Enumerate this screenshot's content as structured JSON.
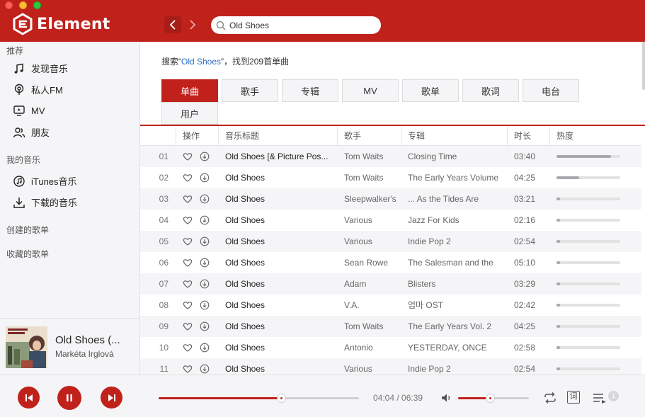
{
  "header": {
    "app_name": "Element",
    "search_value": "Old Shoes",
    "colors": {
      "brand": "#c0221b",
      "link": "#2b6fc5"
    }
  },
  "sidebar": {
    "section_recommend": "推荐",
    "items_recommend": [
      {
        "label": "发现音乐",
        "icon": "music-note-icon"
      },
      {
        "label": "私人FM",
        "icon": "radio-icon"
      },
      {
        "label": "MV",
        "icon": "tv-icon"
      },
      {
        "label": "朋友",
        "icon": "friends-icon"
      }
    ],
    "section_my_music": "我的音乐",
    "items_my_music": [
      {
        "label": "iTunes音乐",
        "icon": "itunes-icon"
      },
      {
        "label": "下载的音乐",
        "icon": "download-icon"
      }
    ],
    "section_created": "创建的歌单",
    "section_collected": "收藏的歌单"
  },
  "now_playing": {
    "title": "Old Shoes (...",
    "artist": "Markéta Irglová"
  },
  "search_result": {
    "prefix": "搜索“",
    "keyword": "Old Shoes",
    "suffix": "”，找到209首单曲"
  },
  "tabs": [
    {
      "label": "单曲",
      "active": true
    },
    {
      "label": "歌手",
      "active": false
    },
    {
      "label": "专辑",
      "active": false
    },
    {
      "label": "MV",
      "active": false
    },
    {
      "label": "歌单",
      "active": false
    },
    {
      "label": "歌词",
      "active": false
    },
    {
      "label": "电台",
      "active": false
    },
    {
      "label": "用户",
      "active": false
    }
  ],
  "table": {
    "headers": {
      "action": "操作",
      "title": "音乐标题",
      "artist": "歌手",
      "album": "专辑",
      "duration": "时长",
      "heat": "热度"
    },
    "rows": [
      {
        "num": "01",
        "title": "Old Shoes [& Picture Pos...",
        "artist": "Tom Waits",
        "album": "Closing Time",
        "duration": "03:40",
        "heat": 0.85
      },
      {
        "num": "02",
        "title": "Old Shoes",
        "artist": "Tom Waits",
        "album": "The Early Years Volume",
        "duration": "04:25",
        "heat": 0.35
      },
      {
        "num": "03",
        "title": "Old Shoes",
        "artist": "Sleepwalker's",
        "album": "... As the Tides Are",
        "duration": "03:21",
        "heat": 0.05
      },
      {
        "num": "04",
        "title": "Old Shoes",
        "artist": "Various",
        "album": "Jazz For Kids",
        "duration": "02:16",
        "heat": 0.05
      },
      {
        "num": "05",
        "title": "Old Shoes",
        "artist": "Various",
        "album": "Indie Pop 2",
        "duration": "02:54",
        "heat": 0.05
      },
      {
        "num": "06",
        "title": "Old Shoes",
        "artist": "Sean Rowe",
        "album": "The Salesman and the",
        "duration": "05:10",
        "heat": 0.05
      },
      {
        "num": "07",
        "title": "Old Shoes",
        "artist": "Adam",
        "album": "Blisters",
        "duration": "03:29",
        "heat": 0.05
      },
      {
        "num": "08",
        "title": "Old Shoes",
        "artist": "V.A.",
        "album": "엄마 OST",
        "duration": "02:42",
        "heat": 0.05
      },
      {
        "num": "09",
        "title": "Old Shoes",
        "artist": "Tom Waits",
        "album": "The Early Years Vol. 2",
        "duration": "04:25",
        "heat": 0.05
      },
      {
        "num": "10",
        "title": "Old Shoes",
        "artist": "Antonio",
        "album": "YESTERDAY, ONCE",
        "duration": "02:58",
        "heat": 0.05
      },
      {
        "num": "11",
        "title": "Old Shoes",
        "artist": "Various",
        "album": "Indie Pop 2",
        "duration": "02:54",
        "heat": 0.05
      }
    ]
  },
  "player": {
    "current_time": "04:04",
    "total_time": "06:39",
    "progress": 0.61,
    "volume": 0.45,
    "lyrics_label": "词",
    "queue_count": "1"
  }
}
